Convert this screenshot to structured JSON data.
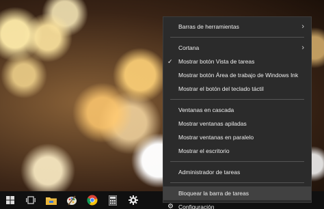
{
  "context_menu": {
    "items": [
      {
        "label": "Barras de herramientas",
        "submenu": true
      },
      {
        "label": "Cortana",
        "submenu": true
      },
      {
        "label": "Mostrar botón Vista de tareas",
        "checked": true
      },
      {
        "label": "Mostrar botón Área de trabajo de Windows Ink"
      },
      {
        "label": "Mostrar el botón del teclado táctil"
      },
      {
        "label": "Ventanas en cascada"
      },
      {
        "label": "Mostrar ventanas apiladas"
      },
      {
        "label": "Mostrar ventanas en paralelo"
      },
      {
        "label": "Mostrar el escritorio"
      },
      {
        "label": "Administrador de tareas"
      },
      {
        "label": "Bloquear la barra de tareas",
        "highlighted": true
      },
      {
        "label": "Configuración"
      }
    ]
  },
  "taskbar": {
    "icons": [
      "windows-logo-icon",
      "task-view-icon",
      "file-explorer-icon",
      "paint-icon",
      "chrome-icon",
      "calculator-icon",
      "settings-icon"
    ]
  }
}
